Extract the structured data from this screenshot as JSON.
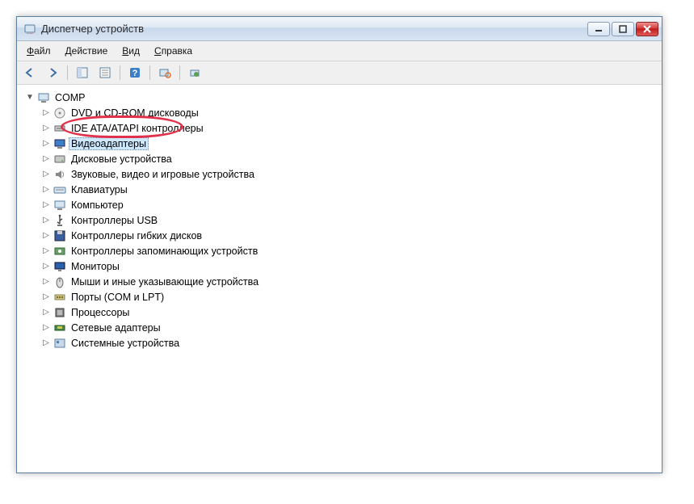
{
  "titlebar": {
    "title": "Диспетчер устройств"
  },
  "menubar": {
    "file": "Файл",
    "action": "Действие",
    "view": "Вид",
    "help": "Справка"
  },
  "toolbar": {
    "back": "back",
    "forward": "forward",
    "showhide": "showhide",
    "properties": "properties",
    "help": "help",
    "scan": "scan",
    "extra": "extra"
  },
  "tree": {
    "root": {
      "label": "COMP",
      "expanded": true
    },
    "items": [
      {
        "id": "dvd",
        "label": "DVD и CD-ROM дисководы",
        "selected": false,
        "icon": "disc"
      },
      {
        "id": "ide",
        "label": "IDE ATA/ATAPI контроллеры",
        "selected": false,
        "icon": "ide"
      },
      {
        "id": "video",
        "label": "Видеоадаптеры",
        "selected": true,
        "icon": "display"
      },
      {
        "id": "disk",
        "label": "Дисковые устройства",
        "selected": false,
        "icon": "hdd"
      },
      {
        "id": "sound",
        "label": "Звуковые, видео и игровые устройства",
        "selected": false,
        "icon": "sound"
      },
      {
        "id": "keyboard",
        "label": "Клавиатуры",
        "selected": false,
        "icon": "keyboard"
      },
      {
        "id": "computer",
        "label": "Компьютер",
        "selected": false,
        "icon": "computer"
      },
      {
        "id": "usb",
        "label": "Контроллеры USB",
        "selected": false,
        "icon": "usb"
      },
      {
        "id": "floppy",
        "label": "Контроллеры гибких дисков",
        "selected": false,
        "icon": "floppy"
      },
      {
        "id": "storage",
        "label": "Контроллеры запоминающих устройств",
        "selected": false,
        "icon": "storage"
      },
      {
        "id": "monitor",
        "label": "Мониторы",
        "selected": false,
        "icon": "monitor"
      },
      {
        "id": "mouse",
        "label": "Мыши и иные указывающие устройства",
        "selected": false,
        "icon": "mouse"
      },
      {
        "id": "ports",
        "label": "Порты (COM и LPT)",
        "selected": false,
        "icon": "port"
      },
      {
        "id": "cpu",
        "label": "Процессоры",
        "selected": false,
        "icon": "cpu"
      },
      {
        "id": "network",
        "label": "Сетевые адаптеры",
        "selected": false,
        "icon": "net"
      },
      {
        "id": "system",
        "label": "Системные устройства",
        "selected": false,
        "icon": "system"
      }
    ]
  }
}
